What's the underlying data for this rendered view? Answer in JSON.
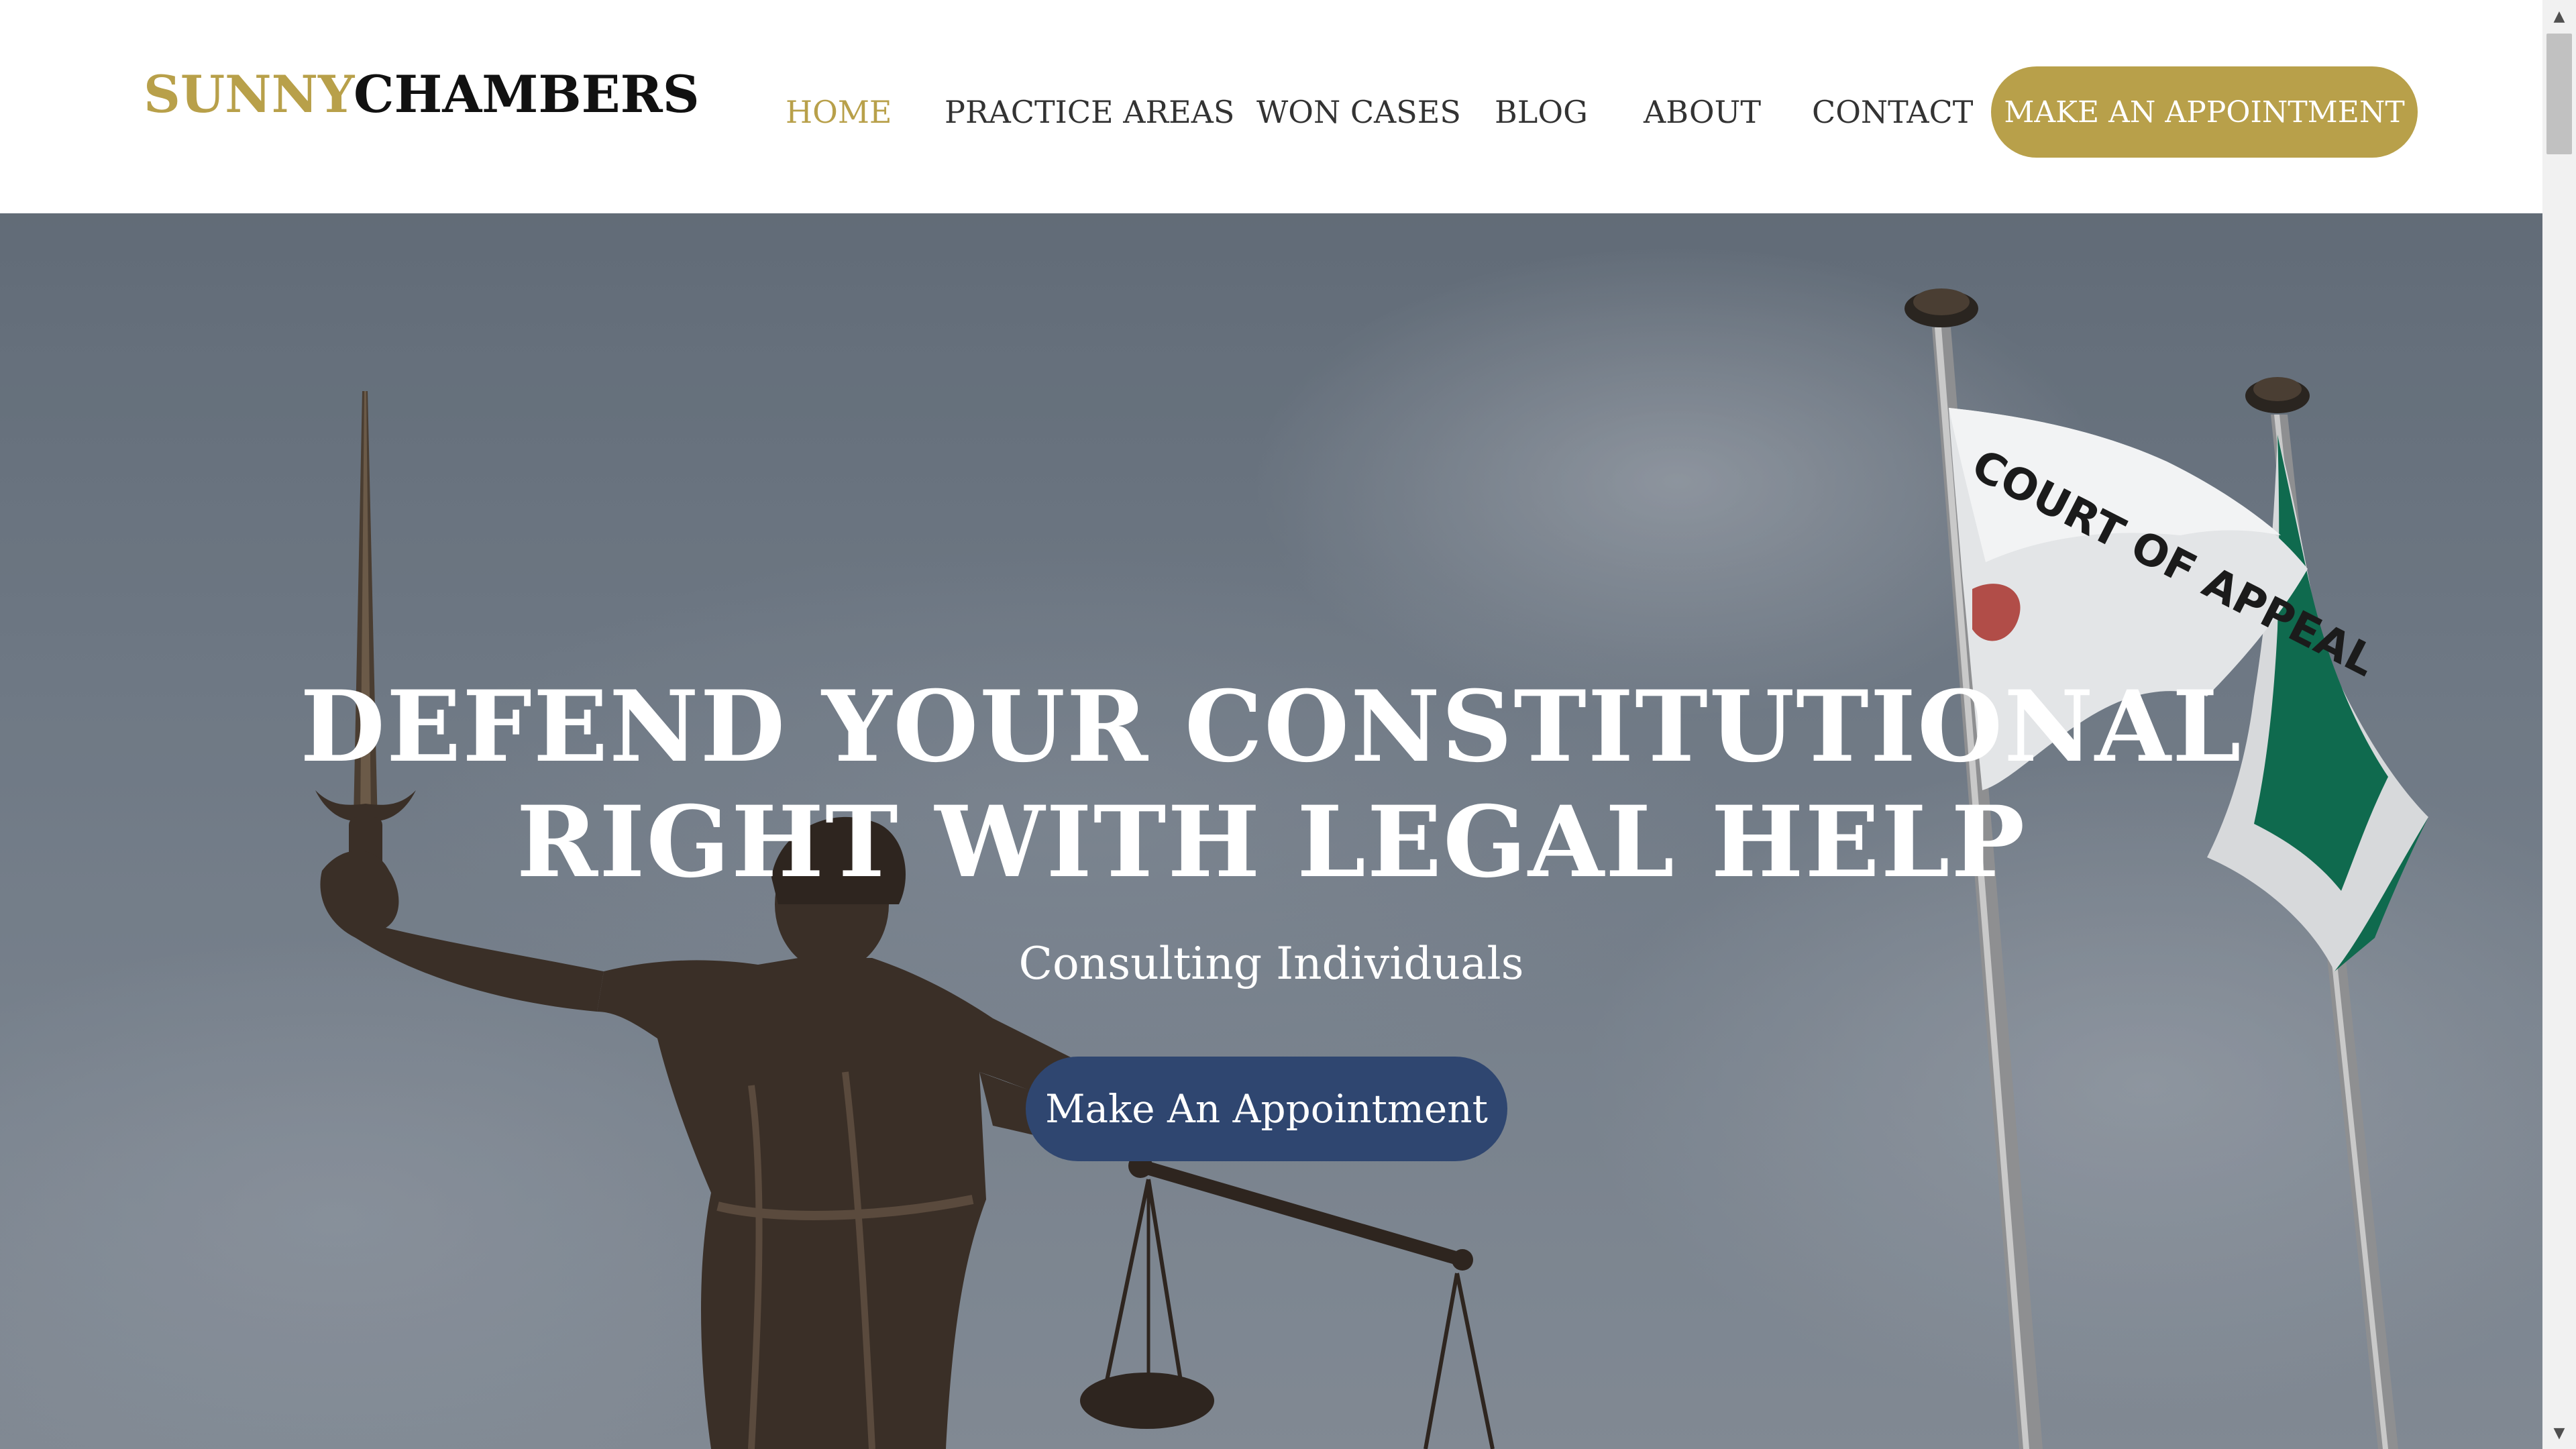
{
  "header": {
    "logo": {
      "part1": "SUNNY",
      "part2": "CHAMBERS"
    },
    "nav": [
      {
        "label": "HOME",
        "active": true
      },
      {
        "label": "PRACTICE AREAS",
        "active": false
      },
      {
        "label": "WON CASES",
        "active": false
      },
      {
        "label": "BLOG",
        "active": false
      },
      {
        "label": "ABOUT",
        "active": false
      },
      {
        "label": "CONTACT",
        "active": false
      }
    ],
    "cta_label": "MAKE AN APPOINTMENT"
  },
  "hero": {
    "title_line1": "DEFEND YOUR CONSTITUTIONAL",
    "title_line2": "RIGHT WITH LEGAL HELP",
    "subtitle": "Consulting Individuals",
    "cta_label": "Make An Appointment",
    "flag_text": "COURT OF APPEAL"
  },
  "colors": {
    "accent_gold": "#b8a04a",
    "hero_button": "#2f4670",
    "text_dark": "#333333"
  },
  "icons": {
    "scroll_up": "scroll-up-arrow-icon",
    "scroll_down": "scroll-down-arrow-icon"
  }
}
